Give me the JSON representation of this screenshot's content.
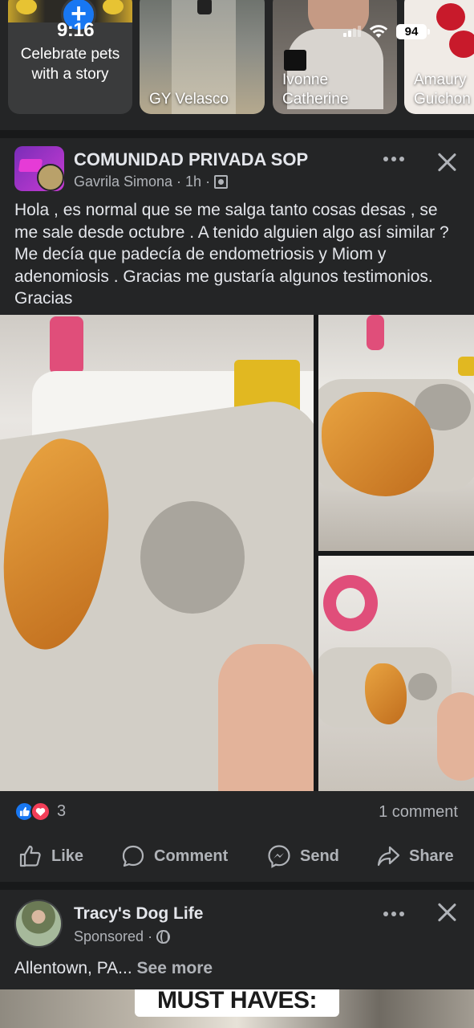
{
  "status_bar": {
    "time": "9:16",
    "battery": "94"
  },
  "stories": {
    "create": {
      "caption": "Celebrate pets with a story",
      "plus_icon": "plus-icon"
    },
    "items": [
      {
        "name": "GY Velasco"
      },
      {
        "name": "Ivonne Catherine"
      },
      {
        "name": "Amaury Guichon"
      }
    ]
  },
  "post": {
    "group_name": "COMUNIDAD PRIVADA SOP",
    "author": "Gavrila Simona",
    "time": "1h",
    "separator": "·",
    "text": "Hola , es normal que se me salga tanto cosas desas , se me sale desde octubre . A tenido alguien algo así similar ? Me decía que padecía de endometriosis y Miom y adenomiosis . Gracias me gustaría algunos testimonios. Gracias",
    "reaction_count": "3",
    "comment_count": "1 comment",
    "actions": {
      "like": "Like",
      "comment": "Comment",
      "send": "Send",
      "share": "Share"
    },
    "colors": {
      "like": "#1877f2",
      "love": "#f33e58"
    }
  },
  "ad": {
    "page_name": "Tracy's Dog Life",
    "label": "Sponsored",
    "separator": "·",
    "text": "Allentown, PA... ",
    "see_more": "See more",
    "banner": "MUST HAVES:"
  }
}
